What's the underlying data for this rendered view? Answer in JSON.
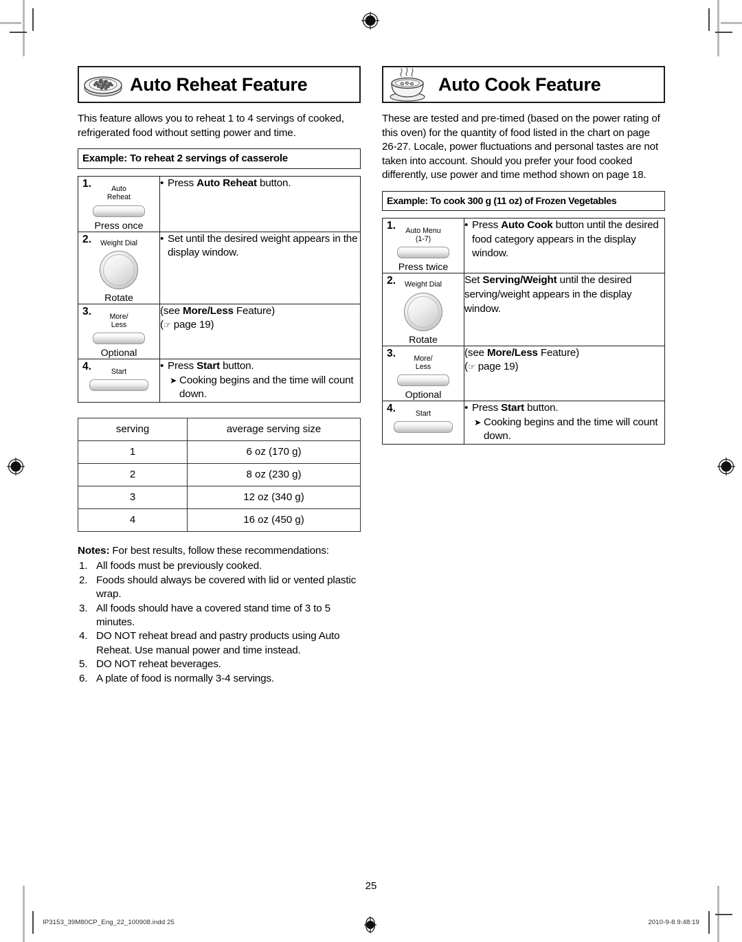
{
  "page": {
    "number": "25",
    "footer_left": "IP3153_39M80CP_Eng_22_100908.indd   25",
    "footer_right": "2010-9-8   9:48:19"
  },
  "left_column": {
    "banner": {
      "title": "Auto Reheat Feature",
      "icon": "plate-of-food-icon"
    },
    "intro": "This feature allows you to reheat 1 to 4 servings of cooked, refrigerated food without setting power and time.",
    "example_bar": "Example: To reheat  2 servings of casserole",
    "steps": [
      {
        "num": "1.",
        "control_label": "Auto\nReheat",
        "control_type": "button",
        "control_foot": "Press once",
        "lines": [
          {
            "style": "bullet",
            "pre": "Press ",
            "bold": "Auto Reheat",
            "post": " button."
          }
        ]
      },
      {
        "num": "2.",
        "control_label": "Weight Dial",
        "control_type": "dial",
        "control_foot": "Rotate",
        "lines": [
          {
            "style": "bullet",
            "pre": "Set until the desired weight appears in the display window.",
            "bold": "",
            "post": ""
          }
        ]
      },
      {
        "num": "3.",
        "control_label": "More/\nLess",
        "control_type": "button",
        "control_foot": "Optional",
        "lines": [
          {
            "style": "plain",
            "pre": "(see ",
            "bold": "More/Less",
            "post": " Feature)"
          },
          {
            "style": "hand",
            "pre": "(",
            "bold": "",
            "post": " page 19)"
          }
        ]
      },
      {
        "num": "4.",
        "control_label": "Start",
        "control_type": "button-wide",
        "control_foot": "",
        "lines": [
          {
            "style": "bullet",
            "pre": "Press ",
            "bold": "Start",
            "post": " button."
          },
          {
            "style": "arrow",
            "pre": "Cooking begins and the time will count down.",
            "bold": "",
            "post": ""
          }
        ]
      }
    ],
    "serving_table": {
      "headers": [
        "serving",
        "average serving size"
      ],
      "rows": [
        [
          "1",
          "6 oz (170 g)"
        ],
        [
          "2",
          "8 oz (230 g)"
        ],
        [
          "3",
          "12 oz (340 g)"
        ],
        [
          "4",
          "16 oz (450 g)"
        ]
      ]
    },
    "notes": {
      "head_bold": "Notes:",
      "head_rest": " For best results, follow these recommendations:",
      "items": [
        "All foods must be previously cooked.",
        "Foods should always be covered with lid or vented plastic wrap.",
        "All foods should have a covered stand time of 3 to 5 minutes.",
        "DO NOT reheat bread and pastry products using Auto Reheat. Use manual power and time instead.",
        "DO NOT reheat beverages.",
        "A plate of food is normally 3-4 servings."
      ]
    }
  },
  "right_column": {
    "banner": {
      "title": "Auto Cook Feature",
      "icon": "steaming-bowl-icon"
    },
    "intro": "These are tested and pre-timed (based on the power rating of this oven) for the quantity of food listed in the chart on page 26-27. Locale, power fluctuations and personal tastes are not taken into account. Should you prefer your food cooked differently, use power and time method shown on page 18.",
    "example_bar": "Example: To cook 300 g (11 oz) of Frozen Vegetables",
    "steps": [
      {
        "num": "1.",
        "control_label": "Auto Menu\n(1-7)",
        "control_type": "button",
        "control_foot": "Press twice",
        "lines": [
          {
            "style": "bullet",
            "pre": "Press ",
            "bold": "Auto Cook",
            "post": " button until the desired food category appears in the display window."
          }
        ]
      },
      {
        "num": "2.",
        "control_label": "Weight Dial",
        "control_type": "dial",
        "control_foot": "Rotate",
        "lines": [
          {
            "style": "plain",
            "pre": "Set ",
            "bold": "Serving/Weight",
            "post": " until the desired serving/weight appears in the display window."
          }
        ]
      },
      {
        "num": "3.",
        "control_label": "More/\nLess",
        "control_type": "button",
        "control_foot": "Optional",
        "lines": [
          {
            "style": "plain",
            "pre": "(see ",
            "bold": "More/Less",
            "post": " Feature)"
          },
          {
            "style": "hand",
            "pre": "(",
            "bold": "",
            "post": " page 19)"
          }
        ]
      },
      {
        "num": "4.",
        "control_label": "Start",
        "control_type": "button-wide",
        "control_foot": "",
        "lines": [
          {
            "style": "bullet",
            "pre": "Press ",
            "bold": "Start",
            "post": " button."
          },
          {
            "style": "arrow",
            "pre": "Cooking begins and the time will count down.",
            "bold": "",
            "post": ""
          }
        ]
      }
    ]
  }
}
